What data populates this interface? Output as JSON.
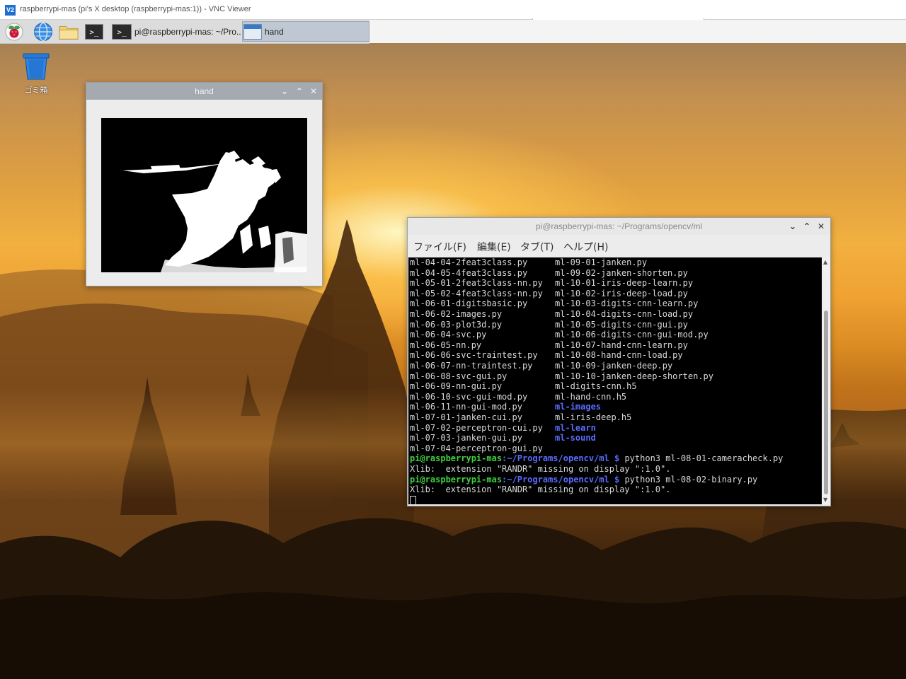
{
  "vnc": {
    "title": "raspberrypi-mas (pi's X desktop (raspberrypi-mas:1)) - VNC Viewer",
    "logo": "V2"
  },
  "panel": {
    "launchers": [
      "raspberry-menu-icon",
      "web-browser-icon",
      "file-manager-icon",
      "terminal-icon"
    ],
    "tasks": [
      {
        "label": "pi@raspberrypi-mas: ~/Pro...",
        "icon": "terminal-icon"
      },
      {
        "label": "hand",
        "icon": "window-icon"
      }
    ],
    "terminal_glyph": ">_"
  },
  "desktop": {
    "trash_label": "ゴミ箱"
  },
  "hand_window": {
    "title": "hand"
  },
  "terminal_window": {
    "title": "pi@raspberrypi-mas: ~/Programs/opencv/ml",
    "menu": [
      "ファイル(F)",
      "編集(E)",
      "タブ(T)",
      "ヘルプ(H)"
    ],
    "listing_left": [
      "ml-04-04-2feat3class.py",
      "ml-04-05-4feat3class.py",
      "ml-05-01-2feat3class-nn.py",
      "ml-05-02-4feat3class-nn.py",
      "ml-06-01-digitsbasic.py",
      "ml-06-02-images.py",
      "ml-06-03-plot3d.py",
      "ml-06-04-svc.py",
      "ml-06-05-nn.py",
      "ml-06-06-svc-traintest.py",
      "ml-06-07-nn-traintest.py",
      "ml-06-08-svc-gui.py",
      "ml-06-09-nn-gui.py",
      "ml-06-10-svc-gui-mod.py",
      "ml-06-11-nn-gui-mod.py",
      "ml-07-01-janken-cui.py",
      "ml-07-02-perceptron-cui.py",
      "ml-07-03-janken-gui.py",
      "ml-07-04-perceptron-gui.py"
    ],
    "listing_right": [
      {
        "text": "ml-09-01-janken.py",
        "dir": false
      },
      {
        "text": "ml-09-02-janken-shorten.py",
        "dir": false
      },
      {
        "text": "ml-10-01-iris-deep-learn.py",
        "dir": false
      },
      {
        "text": "ml-10-02-iris-deep-load.py",
        "dir": false
      },
      {
        "text": "ml-10-03-digits-cnn-learn.py",
        "dir": false
      },
      {
        "text": "ml-10-04-digits-cnn-load.py",
        "dir": false
      },
      {
        "text": "ml-10-05-digits-cnn-gui.py",
        "dir": false
      },
      {
        "text": "ml-10-06-digits-cnn-gui-mod.py",
        "dir": false
      },
      {
        "text": "ml-10-07-hand-cnn-learn.py",
        "dir": false
      },
      {
        "text": "ml-10-08-hand-cnn-load.py",
        "dir": false
      },
      {
        "text": "ml-10-09-janken-deep.py",
        "dir": false
      },
      {
        "text": "ml-10-10-janken-deep-shorten.py",
        "dir": false
      },
      {
        "text": "ml-digits-cnn.h5",
        "dir": false
      },
      {
        "text": "ml-hand-cnn.h5",
        "dir": false
      },
      {
        "text": "ml-images",
        "dir": true
      },
      {
        "text": "ml-iris-deep.h5",
        "dir": false
      },
      {
        "text": "ml-learn",
        "dir": true
      },
      {
        "text": "ml-sound",
        "dir": true
      }
    ],
    "prompt_user": "pi@raspberrypi-mas",
    "prompt_path": ":~/Programs/opencv/ml $",
    "commands": [
      {
        "cmd": " python3 ml-08-01-cameracheck.py",
        "output": "Xlib:  extension \"RANDR\" missing on display \":1.0\"."
      },
      {
        "cmd": " python3 ml-08-02-binary.py",
        "output": "Xlib:  extension \"RANDR\" missing on display \":1.0\"."
      }
    ]
  },
  "colors": {
    "prompt_user": "#3fd03f",
    "prompt_path": "#5a6cff",
    "directory": "#5a6cff"
  }
}
